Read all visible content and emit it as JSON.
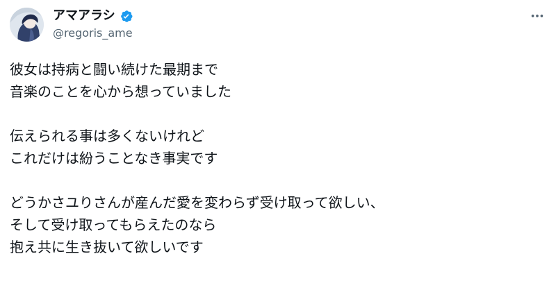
{
  "author": {
    "display_name": "アマアラシ",
    "handle": "@regoris_ame",
    "avatar_icon": "profile-avatar-icon",
    "verified_icon": "verified-badge-icon",
    "verified_color": "#1d9bf0"
  },
  "header": {
    "more_icon": "more-options-icon"
  },
  "tweet": {
    "paragraphs": [
      {
        "lines": [
          "彼女は持病と闘い続けた最期まで",
          "音楽のことを心から想っていました"
        ]
      },
      {
        "lines": [
          "伝えられる事は多くないけれど",
          "これだけは紛うことなき事実です"
        ]
      },
      {
        "lines": [
          "どうかさユりさんが産んだ愛を変わらず受け取って欲しい、",
          "そして受け取ってもらえたのなら",
          "抱え共に生き抜いて欲しいです"
        ]
      }
    ]
  },
  "colors": {
    "text_primary": "#0f1419",
    "text_secondary": "#536471",
    "background": "#ffffff"
  }
}
